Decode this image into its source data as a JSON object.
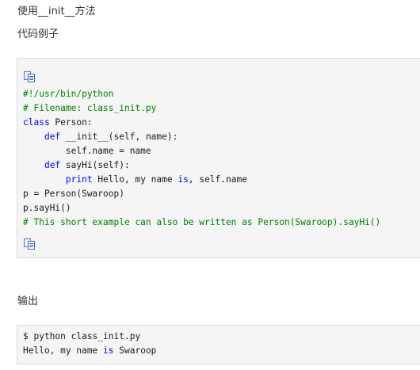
{
  "headings": {
    "title": "使用__init__方法",
    "example_label": "代码例子",
    "output_label": "输出"
  },
  "code_block": {
    "lines": [
      [
        {
          "t": "#!/usr/bin/python",
          "c": "cm"
        }
      ],
      [
        {
          "t": "# Filename: class_init.py",
          "c": "cm"
        }
      ],
      [
        {
          "t": "class",
          "c": "kw"
        },
        {
          "t": " Person:",
          "c": ""
        }
      ],
      [
        {
          "t": "    ",
          "c": ""
        },
        {
          "t": "def",
          "c": "kw"
        },
        {
          "t": " __init__(self, name):",
          "c": ""
        }
      ],
      [
        {
          "t": "        self.name = name",
          "c": ""
        }
      ],
      [
        {
          "t": "    ",
          "c": ""
        },
        {
          "t": "def",
          "c": "kw"
        },
        {
          "t": " sayHi(self):",
          "c": ""
        }
      ],
      [
        {
          "t": "        ",
          "c": ""
        },
        {
          "t": "print",
          "c": "kw"
        },
        {
          "t": " Hello, my name ",
          "c": ""
        },
        {
          "t": "is",
          "c": "kw"
        },
        {
          "t": ", self.name",
          "c": ""
        }
      ],
      [
        {
          "t": "p = Person(Swaroop)",
          "c": ""
        }
      ],
      [
        {
          "t": "p.sayHi()",
          "c": ""
        }
      ],
      [
        {
          "t": "# This short example can also be written as Person(Swaroop).sayHi()",
          "c": "cm"
        }
      ]
    ],
    "icon": "copy-code-icon"
  },
  "output_block": {
    "lines": [
      [
        {
          "t": "$ python class_init.py",
          "c": ""
        }
      ],
      [
        {
          "t": "Hello, my name ",
          "c": ""
        },
        {
          "t": "is",
          "c": "kw"
        },
        {
          "t": " Swaroop",
          "c": ""
        }
      ]
    ]
  },
  "colors": {
    "keyword": "#0000ff",
    "comment": "#008000",
    "code_background": "#f5f5f5",
    "border": "#d9d9d9"
  }
}
